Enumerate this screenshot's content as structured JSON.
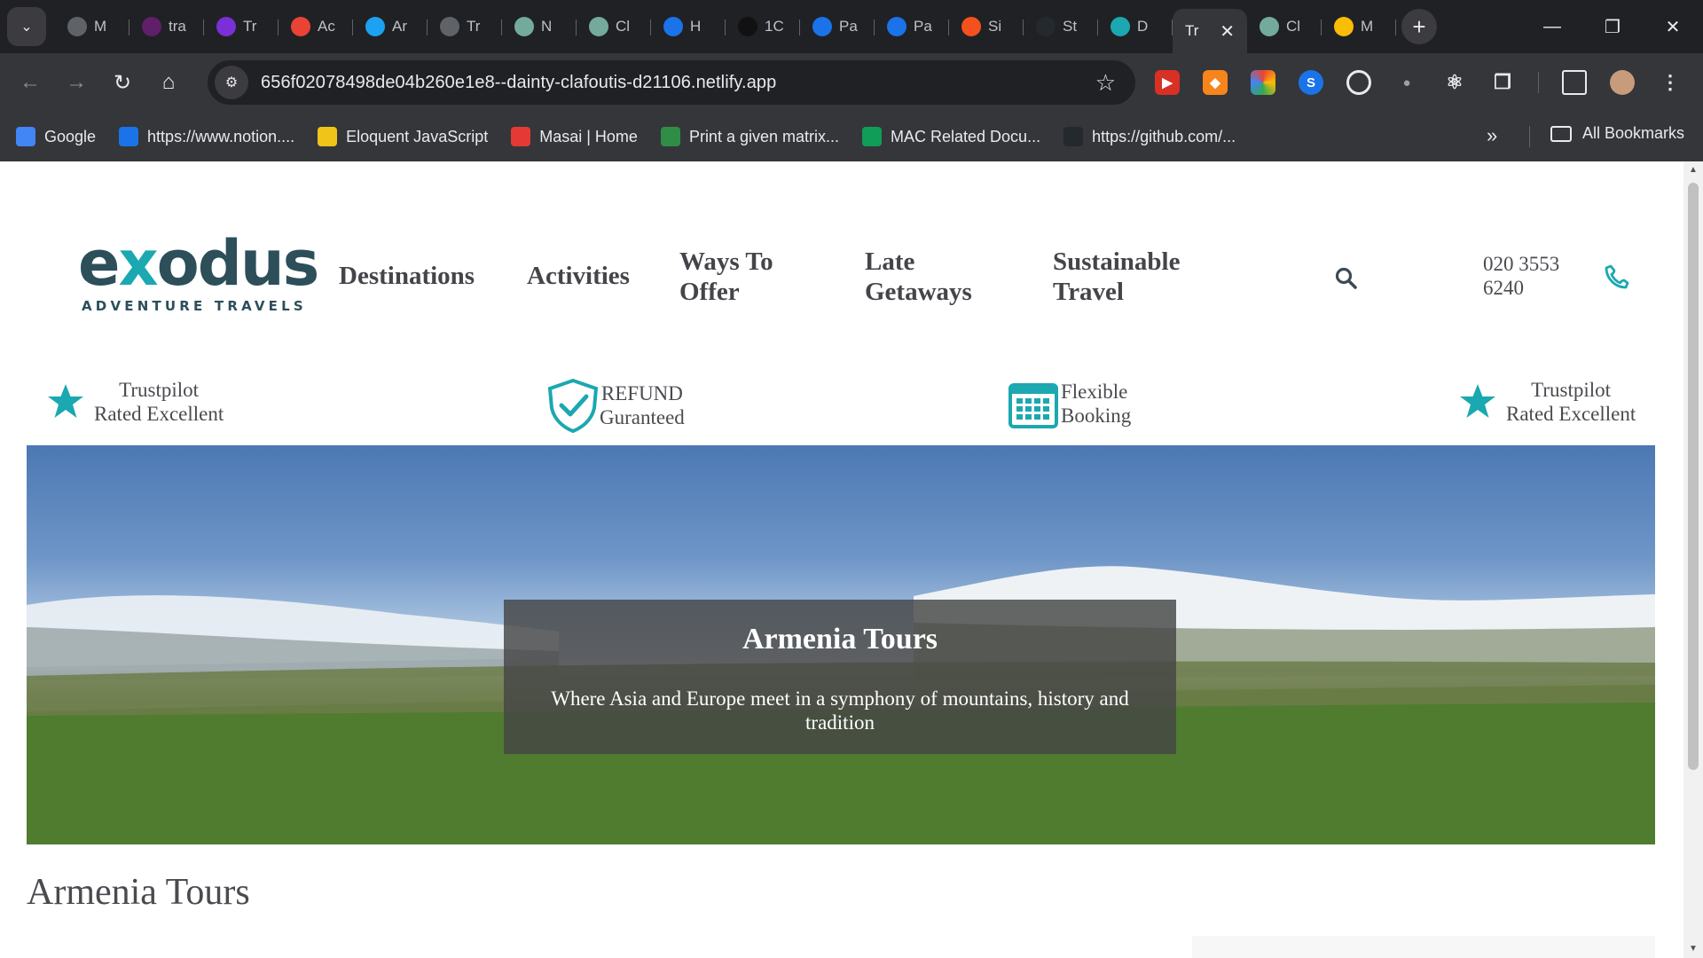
{
  "browser": {
    "tabs": [
      {
        "label": "M",
        "favicon": "globe-icon",
        "color": "#5f6368"
      },
      {
        "label": "tra",
        "favicon": "slack-icon",
        "color": "#611f69"
      },
      {
        "label": "Tr",
        "favicon": "list-icon",
        "color": "#7b2fd6"
      },
      {
        "label": "Ac",
        "favicon": "gmail-icon",
        "color": "#ea4335"
      },
      {
        "label": "Ar",
        "favicon": "x-icon",
        "color": "#1da1f2"
      },
      {
        "label": "Tr",
        "favicon": "globe-icon",
        "color": "#5f6368"
      },
      {
        "label": "N",
        "favicon": "chatgpt-icon",
        "color": "#74aa9c"
      },
      {
        "label": "Cl",
        "favicon": "chatgpt-icon",
        "color": "#74aa9c"
      },
      {
        "label": "H",
        "favicon": "flag-icon",
        "color": "#1a73e8"
      },
      {
        "label": "1C",
        "favicon": "code-icon",
        "color": "#111111"
      },
      {
        "label": "Pa",
        "favicon": "wifi-icon",
        "color": "#1a73e8"
      },
      {
        "label": "Pa",
        "favicon": "wifi-icon",
        "color": "#1a73e8"
      },
      {
        "label": "Si",
        "favicon": "sign-icon",
        "color": "#f4511e"
      },
      {
        "label": "St",
        "favicon": "github-icon",
        "color": "#24292e"
      },
      {
        "label": "D",
        "favicon": "diamond-icon",
        "color": "#1ba8b0"
      },
      {
        "label": "Tr",
        "favicon": "none",
        "color": "#35363a",
        "active": true
      },
      {
        "label": "Cl",
        "favicon": "chatgpt-icon",
        "color": "#74aa9c"
      },
      {
        "label": "M",
        "favicon": "drive-icon",
        "color": "#fbbc04"
      }
    ],
    "url": "656f02078498de04b260e1e8--dainty-clafoutis-d21106.netlify.app",
    "bookmarks": [
      {
        "label": "Google",
        "icon": "google-icon",
        "color": "#4285f4"
      },
      {
        "label": "https://www.notion....",
        "icon": "monitor-icon",
        "color": "#1a73e8"
      },
      {
        "label": "Eloquent JavaScript",
        "icon": "ejs-icon",
        "color": "#f0c419"
      },
      {
        "label": "Masai | Home",
        "icon": "masai-icon",
        "color": "#e53935"
      },
      {
        "label": "Print a given matrix...",
        "icon": "gfg-icon",
        "color": "#2f8d46"
      },
      {
        "label": "MAC Related Docu...",
        "icon": "plus-doc-icon",
        "color": "#0f9d58"
      },
      {
        "label": "https://github.com/...",
        "icon": "github-icon",
        "color": "#24292e"
      }
    ],
    "all_bookmarks": "All Bookmarks"
  },
  "site": {
    "logo_word": "exodus",
    "logo_sub": "ADVENTURE TRAVELS",
    "nav": [
      "Destinations",
      "Activities",
      "Ways To Offer",
      "Late Getaways",
      "Sustainable Travel"
    ],
    "phone": "020 3553 6240",
    "badges": [
      {
        "line1": "Trustpilot",
        "line2": "Rated Excellent",
        "icon": "star-icon"
      },
      {
        "line1": "REFUND",
        "line2": "Guranteed",
        "icon": "shield-check-icon"
      },
      {
        "line1": "Flexible",
        "line2": "Booking",
        "icon": "calendar-icon"
      },
      {
        "line1": "Trustpilot",
        "line2": "Rated Excellent",
        "icon": "star-icon"
      }
    ],
    "hero": {
      "title": "Armenia Tours",
      "description": "Where Asia and Europe meet in a symphony of mountains, history and tradition"
    },
    "page_heading": "Armenia Tours"
  },
  "colors": {
    "brand_teal": "#1ba8b0",
    "brand_dark": "#2c4f5a"
  }
}
